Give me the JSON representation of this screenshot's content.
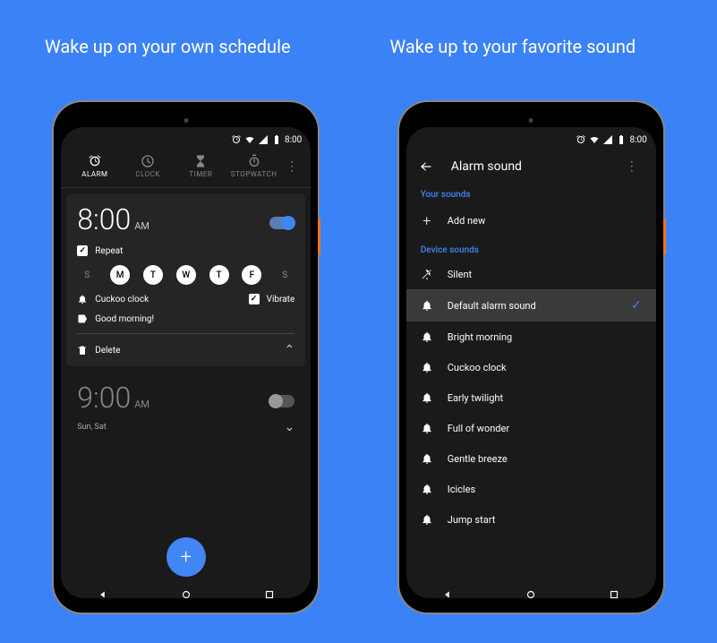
{
  "headlines": {
    "left": "Wake up on your own schedule",
    "right": "Wake up to your favorite sound"
  },
  "statusbar": {
    "time": "8:00"
  },
  "phone1": {
    "tabs": [
      "ALARM",
      "CLOCK",
      "TIMER",
      "STOPWATCH"
    ],
    "alarm1": {
      "time": "8:00",
      "ampm": "AM",
      "repeat": "Repeat",
      "days": [
        {
          "label": "S",
          "on": false
        },
        {
          "label": "M",
          "on": true
        },
        {
          "label": "T",
          "on": true
        },
        {
          "label": "W",
          "on": true
        },
        {
          "label": "T",
          "on": true
        },
        {
          "label": "F",
          "on": true
        },
        {
          "label": "S",
          "on": false
        }
      ],
      "sound": "Cuckoo clock",
      "vibrate": "Vibrate",
      "label": "Good morning!",
      "delete": "Delete"
    },
    "alarm2": {
      "time": "9:00",
      "ampm": "AM",
      "summary": "Sun, Sat"
    }
  },
  "phone2": {
    "title": "Alarm sound",
    "section1": "Your sounds",
    "addnew": "Add new",
    "section2": "Device sounds",
    "sounds": [
      "Silent",
      "Default alarm sound",
      "Bright morning",
      "Cuckoo clock",
      "Early twilight",
      "Full of wonder",
      "Gentle breeze",
      "Icicles",
      "Jump start"
    ],
    "selected": "Default alarm sound"
  }
}
